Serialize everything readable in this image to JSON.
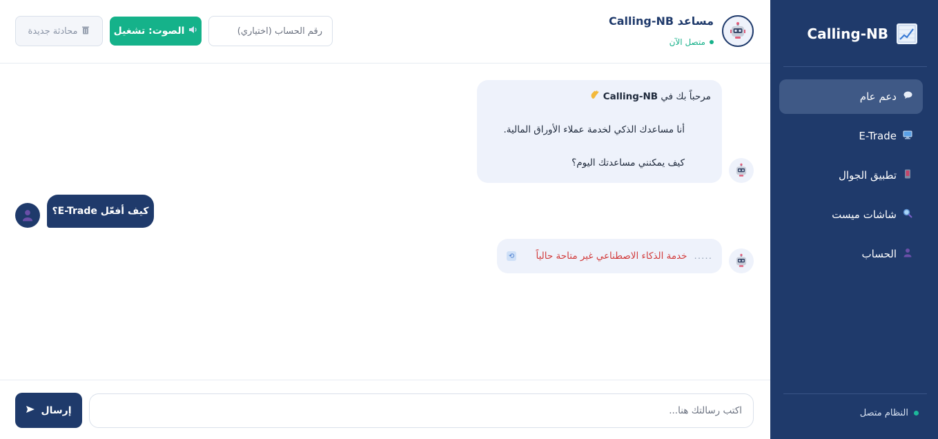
{
  "sidebar": {
    "brand_title": "Calling-NB",
    "brand_icon": "chart-trending-up-icon",
    "items": [
      {
        "label": "دعم عام",
        "icon": "speech-bubble-icon",
        "active": true
      },
      {
        "label": "E-Trade",
        "icon": "desktop-computer-icon",
        "active": false
      },
      {
        "label": "تطبيق الجوال",
        "icon": "mobile-phone-icon",
        "active": false
      },
      {
        "label": "شاشات ميست",
        "icon": "magnifier-icon",
        "active": false
      },
      {
        "label": "الحساب",
        "icon": "user-icon",
        "active": false
      }
    ],
    "status_text": "النظام متصل"
  },
  "header": {
    "title": "مساعد Calling-NB",
    "status": "متصل الآن",
    "account_placeholder": "رقم الحساب (اختياري)",
    "voice_label": "الصوت: تشغيل",
    "new_chat_label": "محادثة جديدة"
  },
  "messages": {
    "welcome_prefix": "مرحباً بك في ",
    "welcome_brand": "Calling-NB",
    "welcome_line2": "أنا مساعدك الذكي لخدمة عملاء الأوراق المالية.",
    "welcome_line3": "كيف يمكنني مساعدتك اليوم؟",
    "user_question": "كيف أفعّل E-Trade؟",
    "error_text": "خدمة الذكاء الاصطناعي غير متاحة حالياً",
    "error_dots": "....."
  },
  "composer": {
    "placeholder": "اكتب رسالتك هنا...",
    "send_label": "إرسال"
  },
  "colors": {
    "sidebar_bg": "#1f3a6b",
    "accent_green": "#15b28a",
    "error_red": "#d23b3b",
    "bot_bubble": "#eef2fb"
  }
}
